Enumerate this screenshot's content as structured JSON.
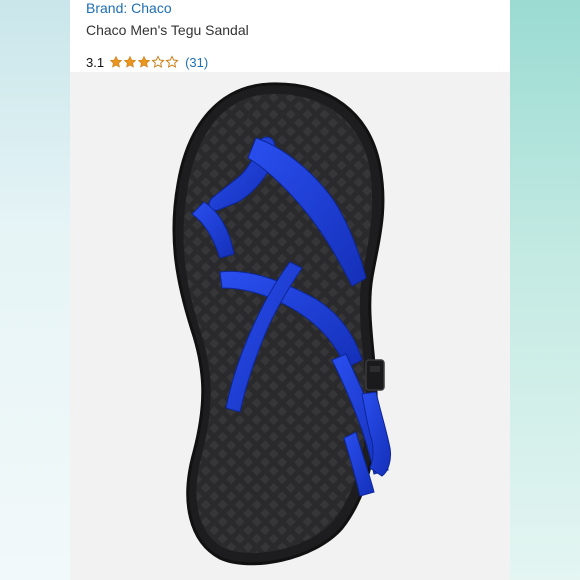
{
  "product": {
    "brand_label": "Brand: Chaco",
    "title": "Chaco Men's Tegu Sandal",
    "rating_value": "3.1",
    "rating_stars": 3.1,
    "review_count": "(31)"
  },
  "colors": {
    "link": "#1f6fb5",
    "star": "#e9951f",
    "strap": "#1f3fd6",
    "sole": "#2b2b2d"
  },
  "image": {
    "subject": "sandal-product-photo"
  }
}
